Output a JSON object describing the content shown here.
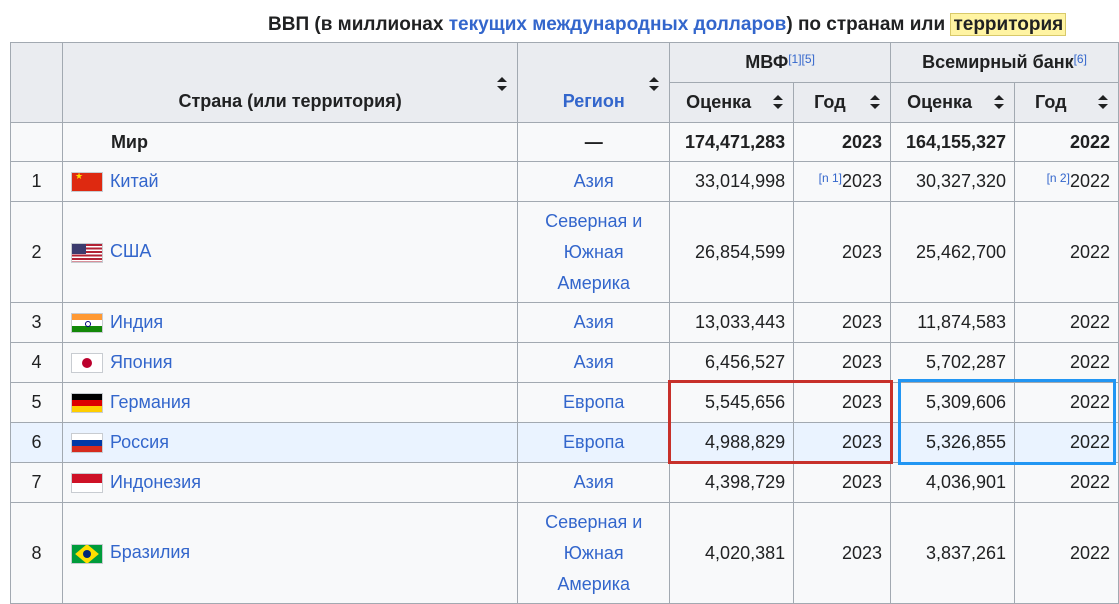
{
  "caption": {
    "part1": "ВВП (в миллионах ",
    "link": "текущих международных долларов",
    "part2": ") по странам или ",
    "highlight": "территория"
  },
  "headers": {
    "country": "Страна (или территория)",
    "region": "Регион",
    "imf": "МВФ",
    "imf_refs": "[1][5]",
    "wb": "Всемирный банк",
    "wb_refs": "[6]",
    "estimate": "Оценка",
    "year": "Год"
  },
  "world": {
    "label": "Мир",
    "region": "—",
    "imf_est": "174,471,283",
    "imf_year": "2023",
    "wb_est": "164,155,327",
    "wb_year": "2022"
  },
  "rows": [
    {
      "rank": "1",
      "flag": "cn",
      "country": "Китай",
      "region_lines": [
        "Азия"
      ],
      "imf_note": "[n 1]",
      "imf_est": "33,014,998",
      "imf_year": "2023",
      "wb_note": "[n 2]",
      "wb_est": "30,327,320",
      "wb_year": "2022"
    },
    {
      "rank": "2",
      "flag": "us",
      "country": "США",
      "region_lines": [
        "Северная и",
        "Южная",
        "Америка"
      ],
      "imf_note": "",
      "imf_est": "26,854,599",
      "imf_year": "2023",
      "wb_note": "",
      "wb_est": "25,462,700",
      "wb_year": "2022"
    },
    {
      "rank": "3",
      "flag": "in",
      "country": "Индия",
      "region_lines": [
        "Азия"
      ],
      "imf_note": "",
      "imf_est": "13,033,443",
      "imf_year": "2023",
      "wb_note": "",
      "wb_est": "11,874,583",
      "wb_year": "2022"
    },
    {
      "rank": "4",
      "flag": "jp",
      "country": "Япония",
      "region_lines": [
        "Азия"
      ],
      "imf_note": "",
      "imf_est": "6,456,527",
      "imf_year": "2023",
      "wb_note": "",
      "wb_est": "5,702,287",
      "wb_year": "2022"
    },
    {
      "rank": "5",
      "flag": "de",
      "country": "Германия",
      "region_lines": [
        "Европа"
      ],
      "imf_note": "",
      "imf_est": "5,545,656",
      "imf_year": "2023",
      "wb_note": "",
      "wb_est": "5,309,606",
      "wb_year": "2022"
    },
    {
      "rank": "6",
      "flag": "ru",
      "country": "Россия",
      "region_lines": [
        "Европа"
      ],
      "imf_note": "",
      "imf_est": "4,988,829",
      "imf_year": "2023",
      "wb_note": "",
      "wb_est": "5,326,855",
      "wb_year": "2022"
    },
    {
      "rank": "7",
      "flag": "id",
      "country": "Индонезия",
      "region_lines": [
        "Азия"
      ],
      "imf_note": "",
      "imf_est": "4,398,729",
      "imf_year": "2023",
      "wb_note": "",
      "wb_est": "4,036,901",
      "wb_year": "2022"
    },
    {
      "rank": "8",
      "flag": "br",
      "country": "Бразилия",
      "region_lines": [
        "Северная и",
        "Южная",
        "Америка"
      ],
      "imf_note": "",
      "imf_est": "4,020,381",
      "imf_year": "2023",
      "wb_note": "",
      "wb_est": "3,837,261",
      "wb_year": "2022"
    }
  ],
  "highlight_boxes": {
    "imf_color": "#c7302a",
    "wb_color": "#2196f3"
  }
}
